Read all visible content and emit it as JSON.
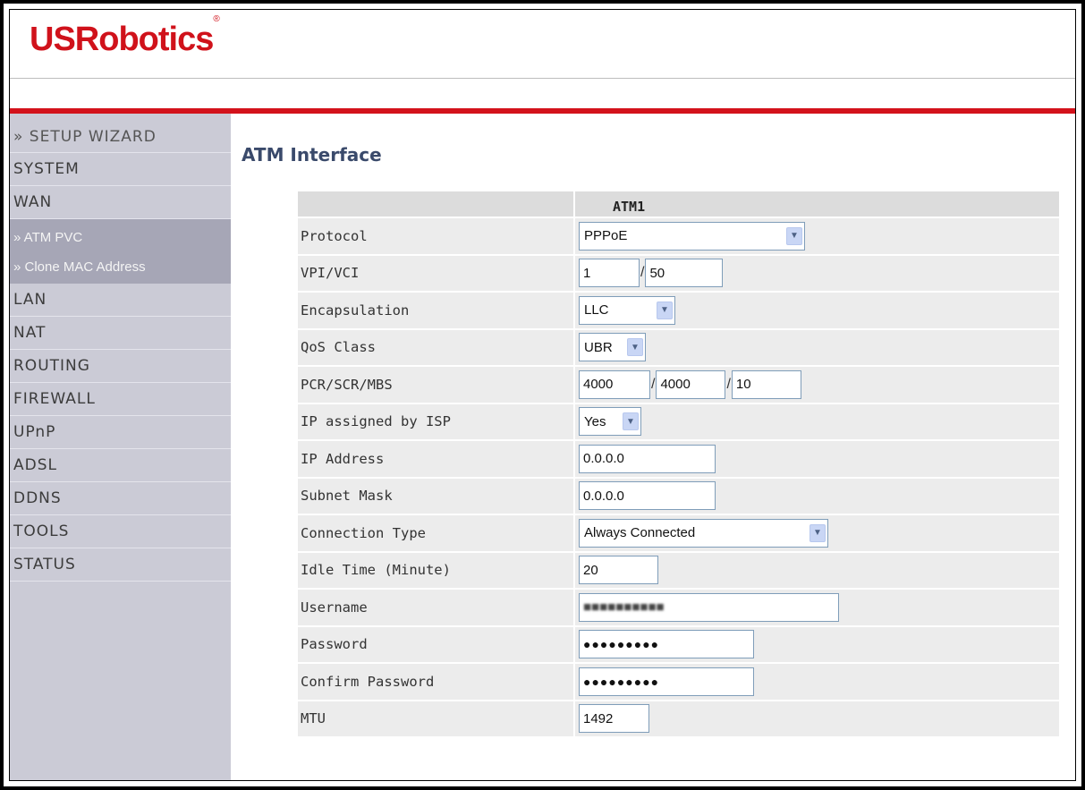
{
  "header": {
    "logo_text": "USRobotics",
    "logo_mark": "®",
    "brand_color": "#d0121b"
  },
  "sidebar": {
    "wizard_label": "» SETUP WIZARD",
    "items_top": [
      "SYSTEM",
      "WAN"
    ],
    "sub_items": [
      "» ATM PVC",
      "» Clone MAC Address"
    ],
    "items_bottom": [
      "LAN",
      "NAT",
      "ROUTING",
      "FIREWALL",
      "UPnP",
      "ADSL",
      "DDNS",
      "TOOLS",
      "STATUS"
    ]
  },
  "main": {
    "title": "ATM Interface",
    "column_header": "ATM1",
    "fields": {
      "protocol": {
        "label": "Protocol",
        "value": "PPPoE"
      },
      "vpi_vci": {
        "label": "VPI/VCI",
        "vpi": "1",
        "vci": "50"
      },
      "encapsulation": {
        "label": "Encapsulation",
        "value": "LLC"
      },
      "qos_class": {
        "label": "QoS Class",
        "value": "UBR"
      },
      "pcr_scr_mbs": {
        "label": "PCR/SCR/MBS",
        "pcr": "4000",
        "scr": "4000",
        "mbs": "10"
      },
      "ip_assigned": {
        "label": "IP assigned by ISP",
        "value": "Yes"
      },
      "ip_address": {
        "label": "IP Address",
        "value": "0.0.0.0"
      },
      "subnet_mask": {
        "label": "Subnet Mask",
        "value": "0.0.0.0"
      },
      "connection_type": {
        "label": "Connection Type",
        "value": "Always Connected"
      },
      "idle_time": {
        "label": "Idle Time (Minute)",
        "value": "20"
      },
      "username": {
        "label": "Username",
        "value": "■■■■■■■■■■"
      },
      "password": {
        "label": "Password",
        "value": "●●●●●●●●●"
      },
      "confirm_password": {
        "label": "Confirm Password",
        "value": "●●●●●●●●●"
      },
      "mtu": {
        "label": "MTU",
        "value": "1492"
      }
    }
  }
}
